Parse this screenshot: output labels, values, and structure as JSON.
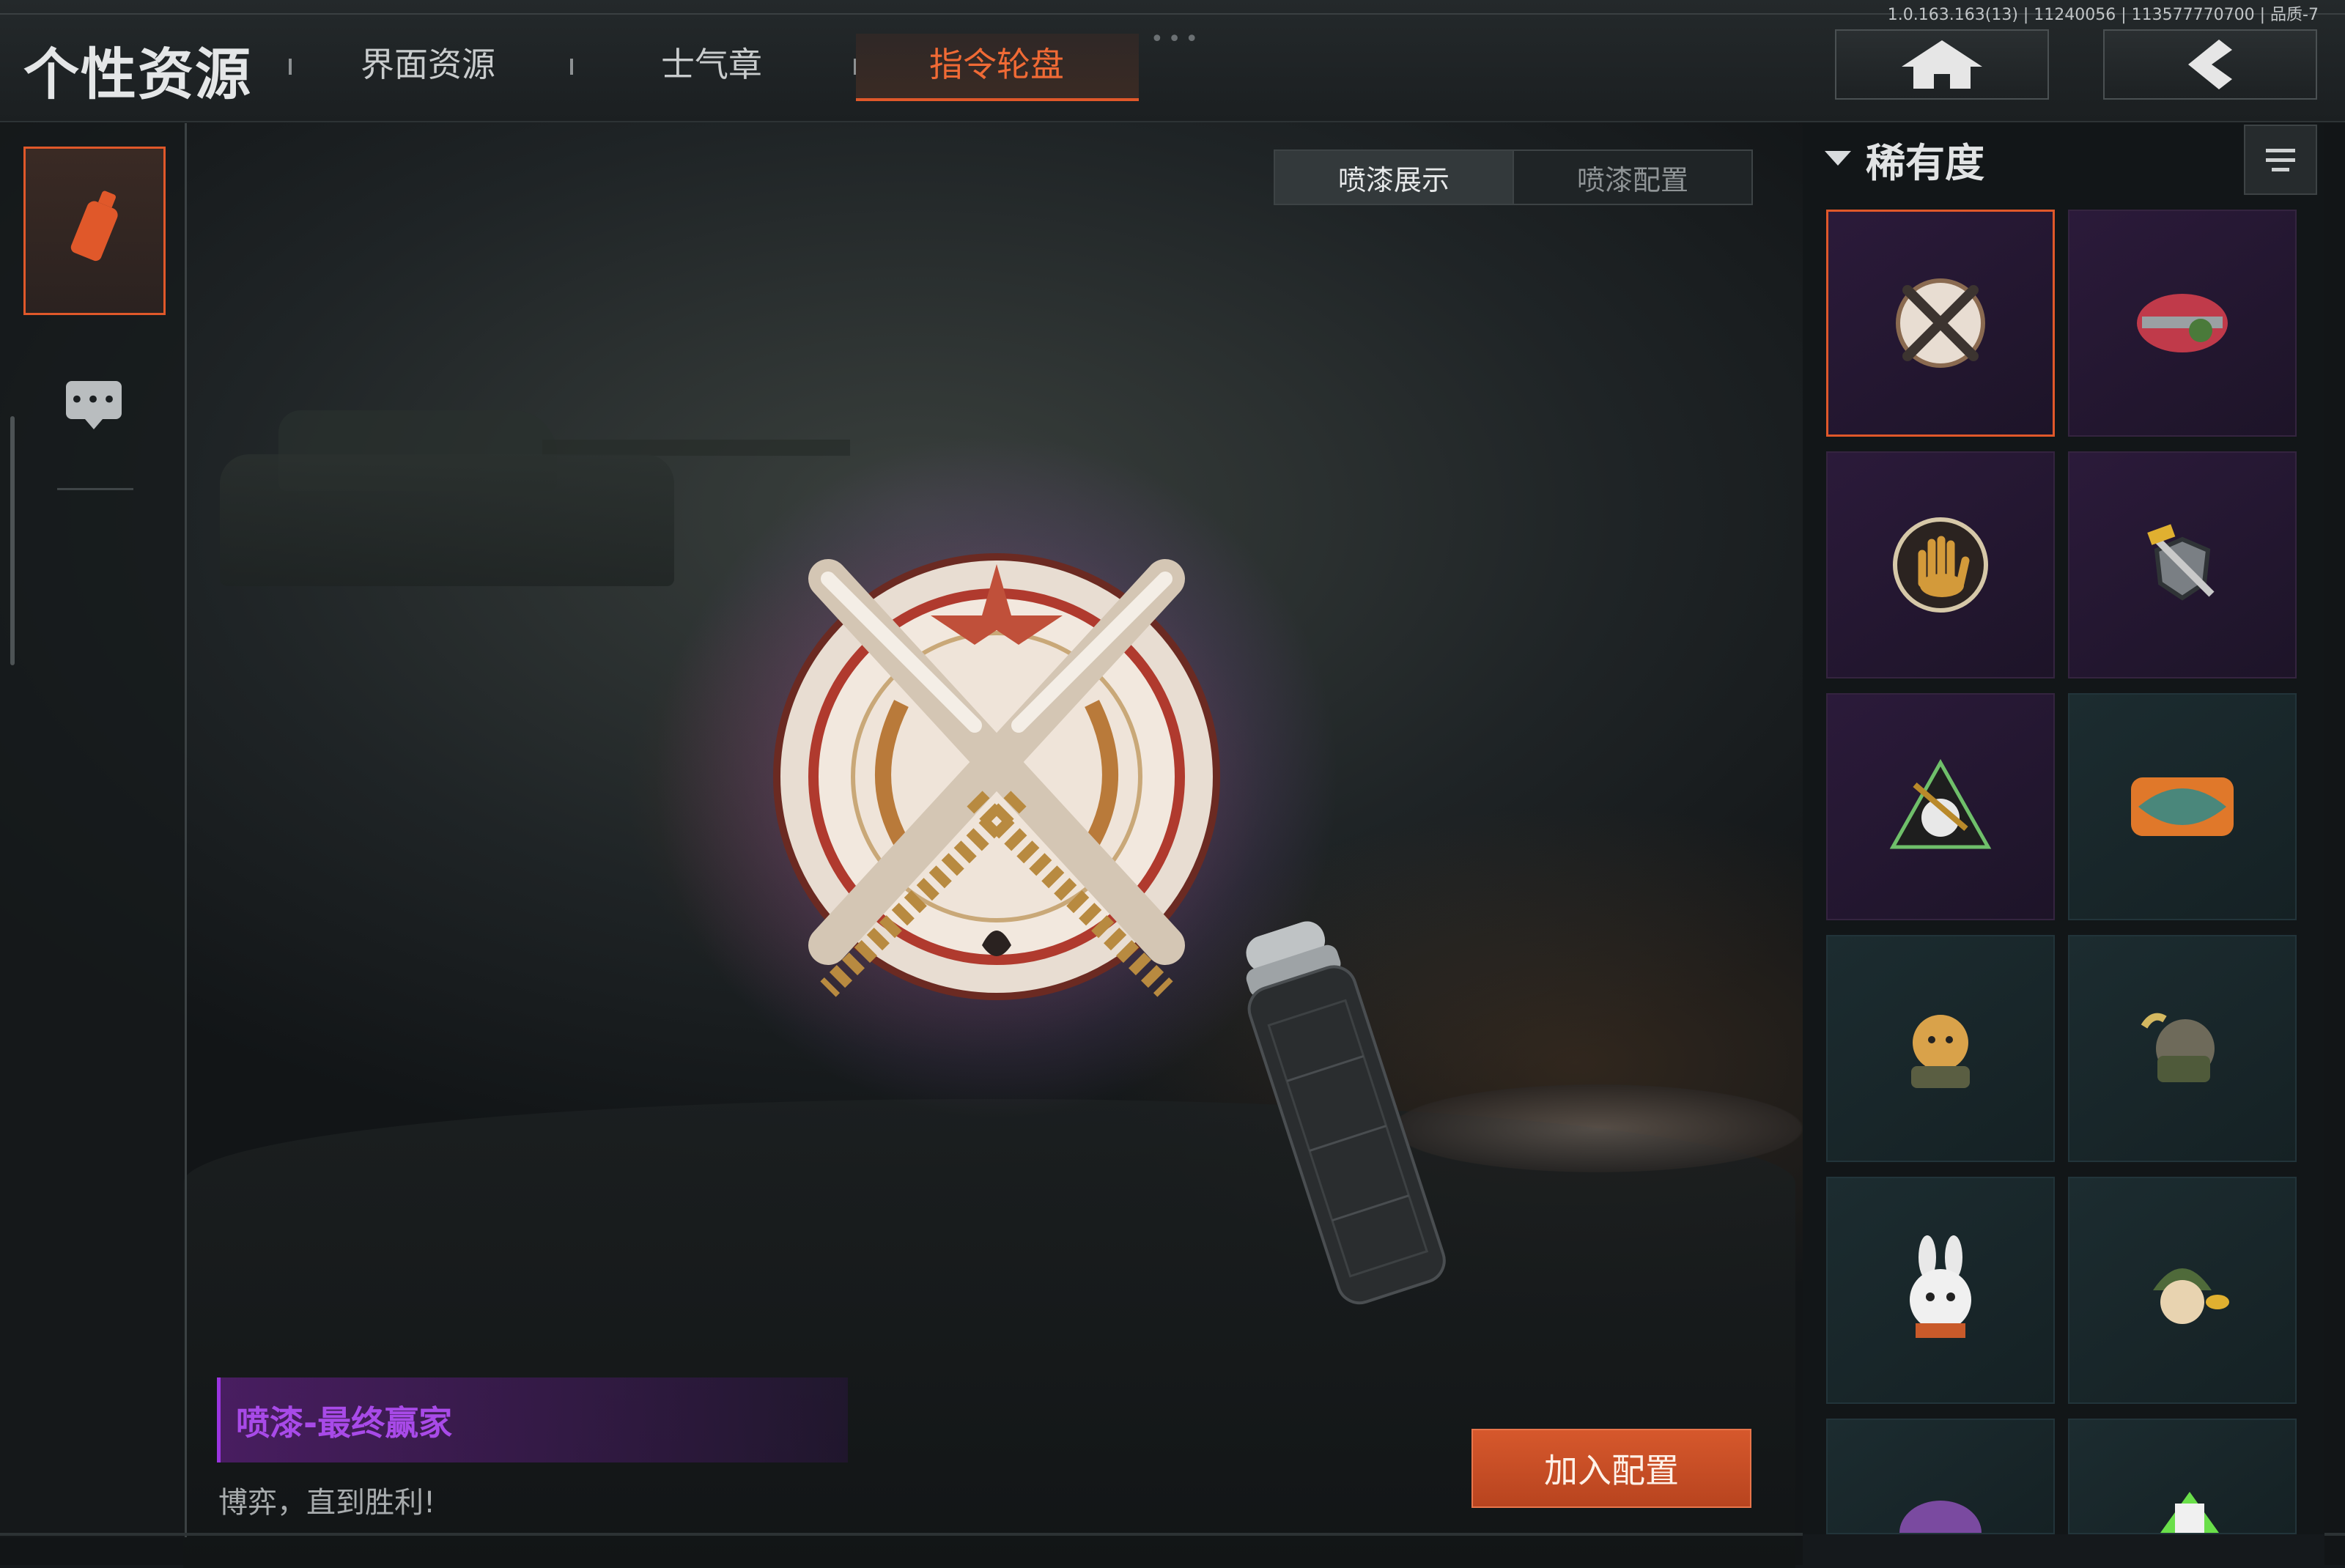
{
  "version_info": "1.0.163.163(13) | 11240056 | 113577770700 | 品质-7",
  "header": {
    "title": "个性资源",
    "tabs": [
      {
        "label": "界面资源",
        "active": false
      },
      {
        "label": "士气章",
        "active": false
      },
      {
        "label": "指令轮盘",
        "active": true
      }
    ],
    "home_icon": "home-icon",
    "back_icon": "back-arrow-icon"
  },
  "left_rail": {
    "items": [
      {
        "icon": "spray-can-icon",
        "selected": true
      },
      {
        "icon": "chat-bubble-icon",
        "selected": false
      }
    ]
  },
  "view_toggle": {
    "options": [
      "喷漆展示",
      "喷漆配置"
    ],
    "selected": "喷漆展示"
  },
  "item": {
    "name": "喷漆-最终赢家",
    "description": "博弈，直到胜利!"
  },
  "actions": {
    "add_label": "加入配置"
  },
  "right_panel": {
    "filter_label": "稀有度",
    "sort_icon": "sort-icon",
    "items": [
      {
        "icon": "crossed-knives-emblem-icon",
        "tier": "purple",
        "selected": true
      },
      {
        "icon": "red-dragon-gun-icon",
        "tier": "purple",
        "selected": false
      },
      {
        "icon": "hand-print-icon",
        "tier": "purple",
        "selected": false
      },
      {
        "icon": "shield-hammer-icon",
        "tier": "purple",
        "selected": false
      },
      {
        "icon": "anthony-rose-triangle-icon",
        "tier": "purple",
        "selected": false
      },
      {
        "icon": "dead-one-graffiti-icon",
        "tier": "teal",
        "selected": false
      },
      {
        "icon": "doge-soldier-icon",
        "tier": "teal",
        "selected": false
      },
      {
        "icon": "rat-soldier-icon",
        "tier": "teal",
        "selected": false
      },
      {
        "icon": "rabbit-icon",
        "tier": "teal",
        "selected": false
      },
      {
        "icon": "helmet-soldier-icon",
        "tier": "teal",
        "selected": false
      },
      {
        "icon": "purple-creature-icon",
        "tier": "teal",
        "selected": false
      },
      {
        "icon": "green-card-icon",
        "tier": "teal",
        "selected": false
      }
    ]
  },
  "colors": {
    "accent": "#e0582a",
    "rarity_purple": "#a84ae8",
    "rarity_teal": "#1c2c30"
  }
}
